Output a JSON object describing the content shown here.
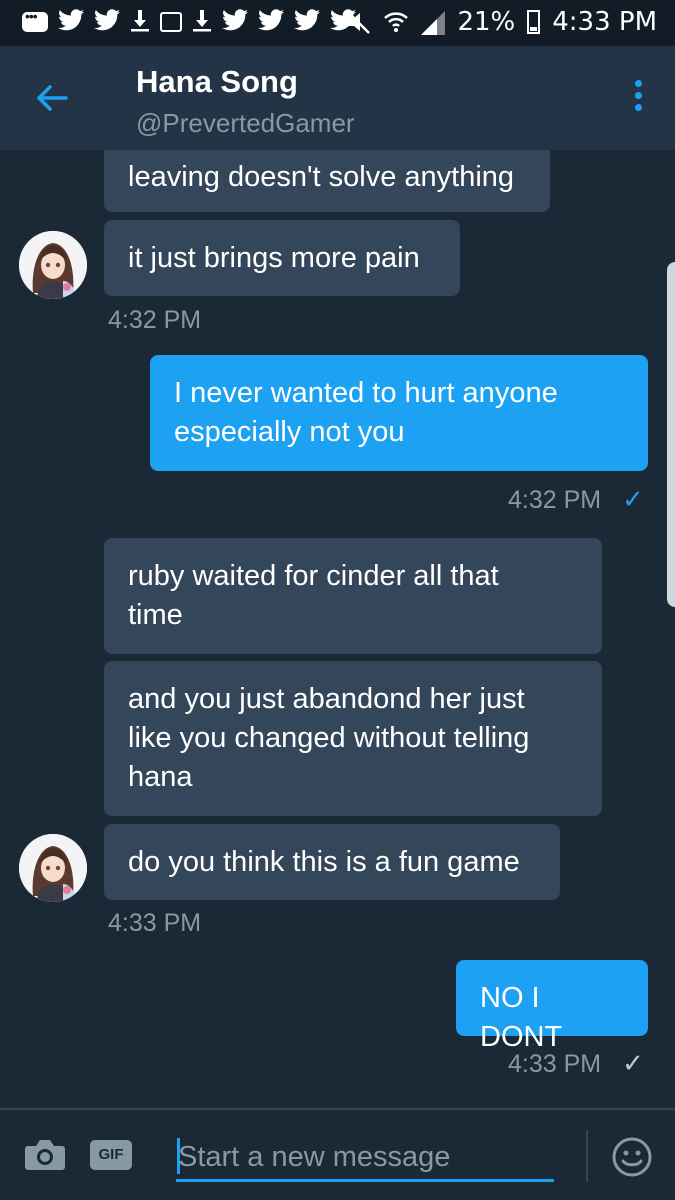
{
  "status_bar": {
    "battery_percent": "21%",
    "time": "4:33 PM"
  },
  "header": {
    "title": "Hana Song",
    "handle": "@PrevertedGamer",
    "back_icon": "arrow-left-icon",
    "menu_icon": "more-vertical-icon"
  },
  "messages": [
    {
      "side": "received",
      "text": "leaving doesn't solve anything"
    },
    {
      "side": "received",
      "text": "it just brings more pain"
    },
    {
      "side": "received",
      "time": "4:32 PM"
    },
    {
      "side": "sent",
      "line1": "I never wanted to hurt anyone",
      "line2": "especially not you"
    },
    {
      "side": "sent",
      "time": "4:32 PM",
      "status": "✓"
    },
    {
      "side": "received",
      "line1": "ruby waited for cinder all that",
      "line2": "time"
    },
    {
      "side": "received",
      "line1": "and you just abandond her just",
      "line2": "like you changed without telling",
      "line3": "hana"
    },
    {
      "side": "received",
      "text": "do you think this is a fun game"
    },
    {
      "side": "received",
      "time": "4:33 PM"
    },
    {
      "side": "sent",
      "text": "NO I DONT"
    },
    {
      "side": "sent",
      "time": "4:33 PM",
      "status": "✓"
    }
  ],
  "composer": {
    "placeholder": "Start a new message",
    "gif_label": "GIF",
    "camera_icon": "camera-icon",
    "emoji_icon": "emoji-icon"
  },
  "colors": {
    "background": "#1b2836",
    "header": "#243447",
    "received_bubble": "#34465a",
    "sent_bubble": "#1da1f2",
    "accent": "#1da1f2",
    "muted_text": "#8899a6"
  }
}
